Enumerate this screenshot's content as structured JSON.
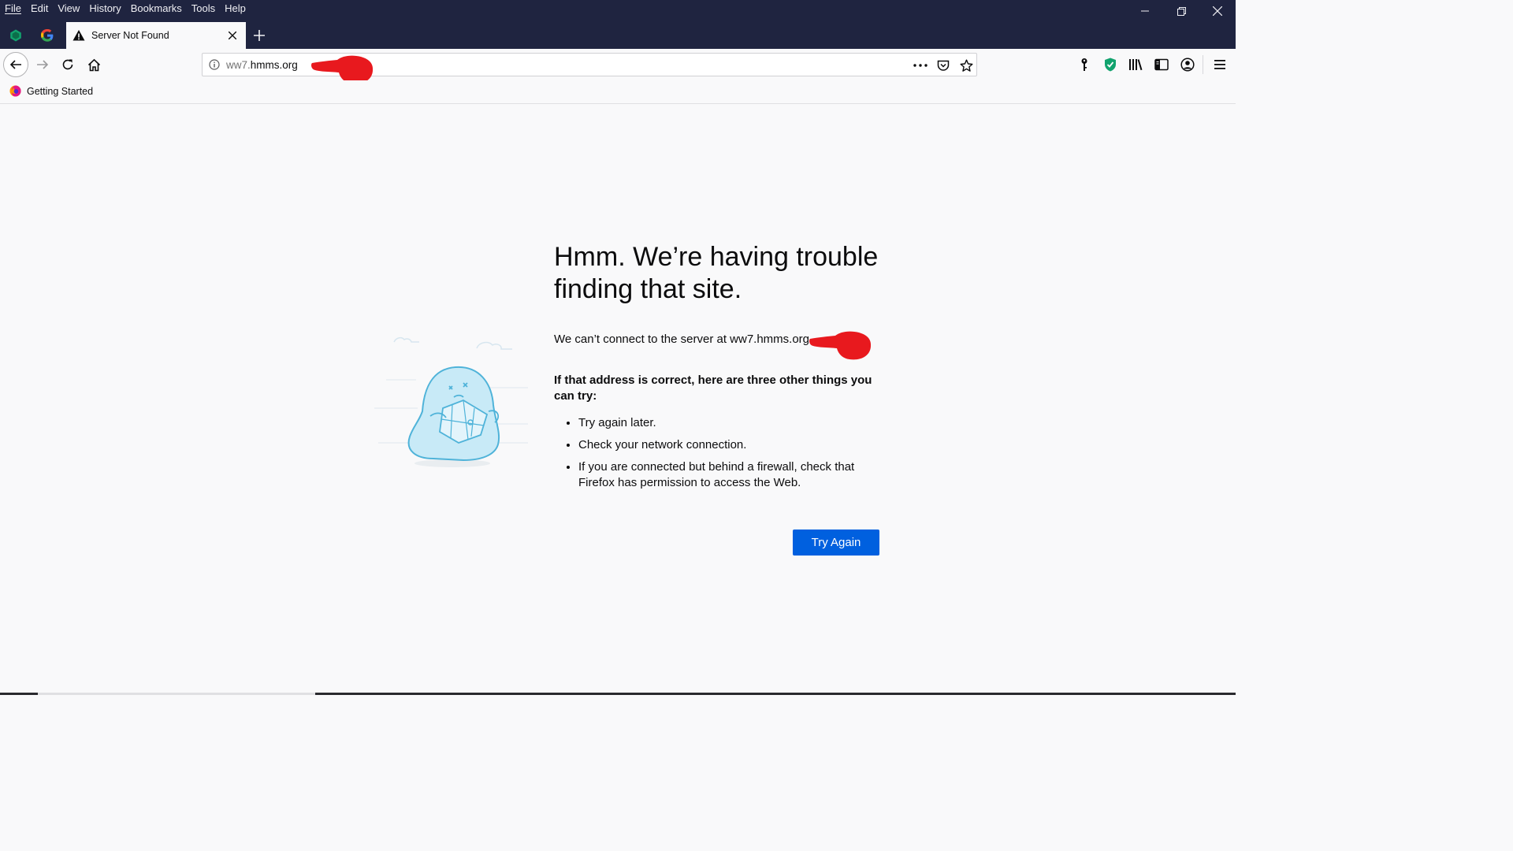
{
  "menu": [
    "File",
    "Edit",
    "View",
    "History",
    "Bookmarks",
    "Tools",
    "Help"
  ],
  "tab": {
    "title": "Server Not Found"
  },
  "url": {
    "prefix": "ww7.",
    "domain": "hmms.org"
  },
  "bookmarks": [
    {
      "label": "Getting Started"
    }
  ],
  "error": {
    "title": "Hmm. We’re having trouble finding that site.",
    "description": "We can’t connect to the server at ww7.hmms.org",
    "things_heading": "If that address is correct, here are three other things you can try:",
    "things": [
      "Try again later.",
      "Check your network connection.",
      "If you are connected but behind a firewall, check that Firefox has permission to access the Web."
    ],
    "try_again": "Try Again"
  },
  "colors": {
    "titlebar": "#1f2440",
    "button": "#0060df",
    "annotation": "#e8191e",
    "illustration": "#4fb3d9"
  }
}
